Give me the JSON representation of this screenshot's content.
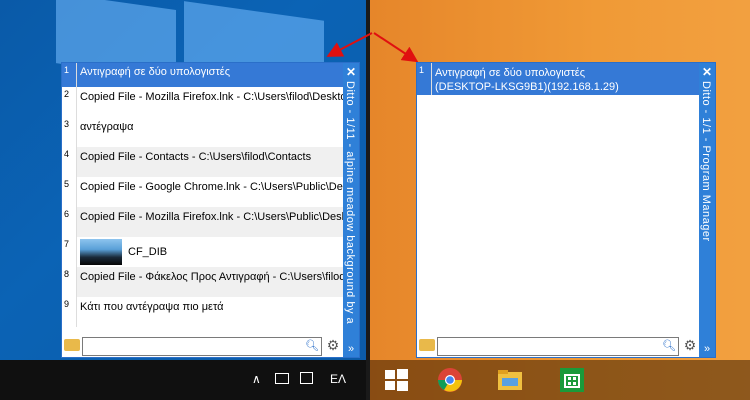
{
  "left_window": {
    "vertical_title": "Ditto - 1/11 - alpine meadow background by a",
    "close": "✕",
    "more": "»",
    "items": [
      {
        "num": "1",
        "text": "Αντιγραφή σε δύο υπολογιστές"
      },
      {
        "num": "2",
        "text": "Copied File - Mozilla Firefox.lnk - C:\\Users\\filod\\Desktop\\"
      },
      {
        "num": "3",
        "text": "αντέγραψα"
      },
      {
        "num": "4",
        "text": "Copied File - Contacts - C:\\Users\\filod\\Contacts"
      },
      {
        "num": "5",
        "text": "Copied File - Google Chrome.lnk - C:\\Users\\Public\\Deskt"
      },
      {
        "num": "6",
        "text": "Copied File - Mozilla Firefox.lnk - C:\\Users\\Public\\Deskto"
      },
      {
        "num": "7",
        "text": "CF_DIB"
      },
      {
        "num": "8",
        "text": "Copied File - Φάκελος Προς Αντιγραφή - C:\\Users\\filod\\D"
      },
      {
        "num": "9",
        "text": "Κάτι που αντέγραψα πιο μετά"
      }
    ],
    "search_value": ""
  },
  "right_window": {
    "vertical_title": "Ditto - 1/1 - Program Manager",
    "close": "✕",
    "more": "»",
    "item_num": "1",
    "item_line1": "Αντιγραφή σε δύο υπολογιστές",
    "item_line2": "(DESKTOP-LKSG9B1)(192.168.1.29)",
    "search_value": ""
  },
  "taskbar_left": {
    "lang": "ΕΛ",
    "chevron": "∧"
  },
  "colors": {
    "accent": "#3579d6",
    "arrow": "#e01010"
  }
}
